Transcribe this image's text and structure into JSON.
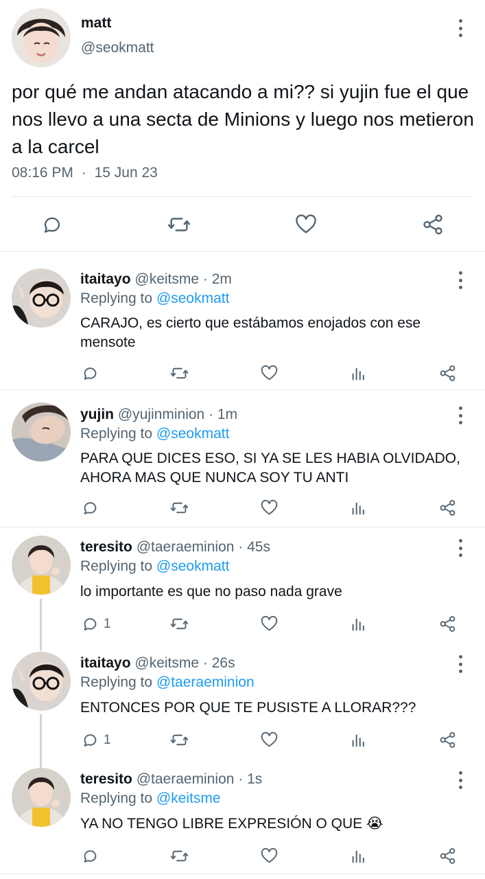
{
  "main_tweet": {
    "display_name": "matt",
    "handle": "@seokmatt",
    "text": "por qué me andan atacando a mi?? si yujin fue el que nos llevo a una secta de Minions y luego nos metieron a la carcel",
    "time": "08:16 PM",
    "separator": "·",
    "date": "15 Jun 23"
  },
  "replies": [
    {
      "display_name": "itaitayo",
      "handle": "@keitsme",
      "separator": "·",
      "time_ago": "2m",
      "replying_prefix": "Replying to",
      "replying_to": "@seokmatt",
      "text": "CARAJO, es cierto que estábamos enojados con ese mensote",
      "reply_count": ""
    },
    {
      "display_name": "yujin",
      "handle": "@yujinminion",
      "separator": "·",
      "time_ago": "1m",
      "replying_prefix": "Replying to",
      "replying_to": "@seokmatt",
      "text": "PARA QUE DICES ESO, SI YA SE LES HABIA OLVIDADO, AHORA MAS QUE NUNCA SOY TU ANTI",
      "reply_count": ""
    },
    {
      "display_name": "teresito",
      "handle": "@taeraeminion",
      "separator": "·",
      "time_ago": "45s",
      "replying_prefix": "Replying to",
      "replying_to": "@seokmatt",
      "text": "lo importante es que no paso nada grave",
      "reply_count": "1"
    },
    {
      "display_name": "itaitayo",
      "handle": "@keitsme",
      "separator": "·",
      "time_ago": "26s",
      "replying_prefix": "Replying to",
      "replying_to": "@taeraeminion",
      "text": "ENTONCES POR QUE TE PUSISTE A LLORAR???",
      "reply_count": "1"
    },
    {
      "display_name": "teresito",
      "handle": "@taeraeminion",
      "separator": "·",
      "time_ago": "1s",
      "replying_prefix": "Replying to",
      "replying_to": "@keitsme",
      "text": "YA NO TENGO LIBRE EXPRESIÓN O QUE 😭",
      "reply_count": ""
    }
  ],
  "icons": {
    "reply": "reply-icon",
    "retweet": "retweet-icon",
    "like": "like-icon",
    "views": "views-icon",
    "share": "share-icon",
    "more": "more-options-icon"
  },
  "colors": {
    "text": "#0f1419",
    "secondary": "#536471",
    "accent": "#1d9bf0",
    "divider": "#e6e8ea"
  }
}
